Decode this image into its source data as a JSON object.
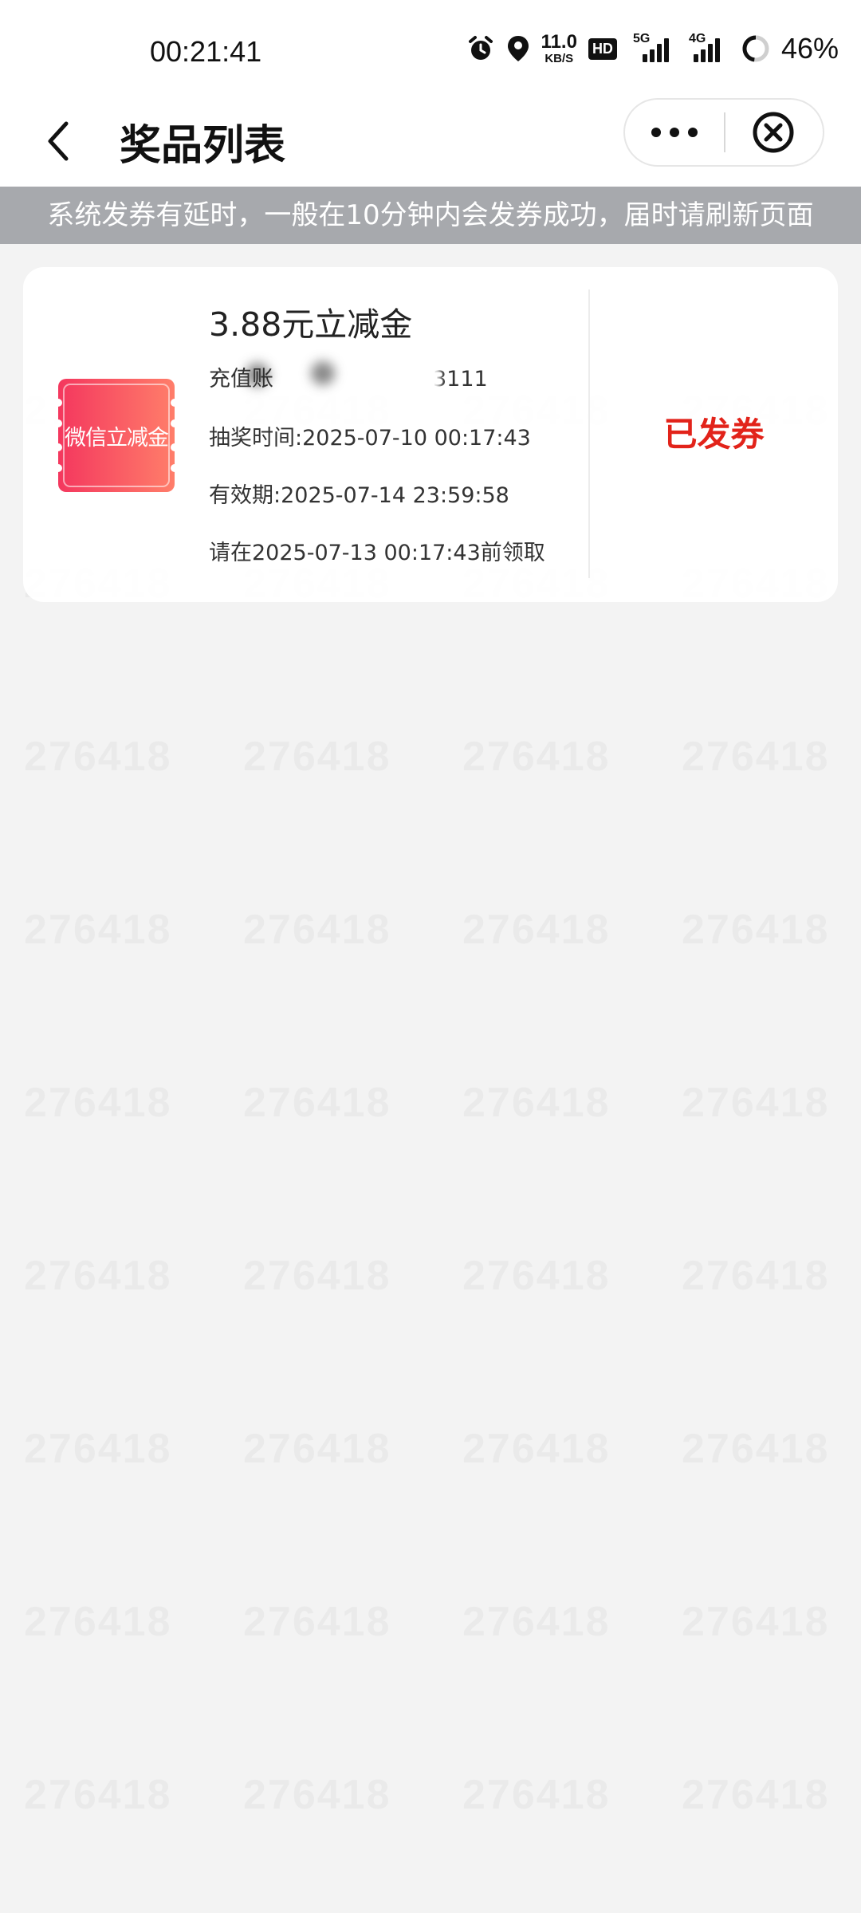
{
  "status_bar": {
    "time": "00:21:41",
    "net_speed_value": "11.0",
    "net_speed_unit": "KB/S",
    "hd_badge": "HD",
    "signal_5g_label": "5G",
    "signal_4g_label": "4G",
    "battery_percent": "46%"
  },
  "header": {
    "title": "奖品列表"
  },
  "notice": {
    "text": "系统发券有延时，一般在10分钟内会发券成功，届时请刷新页面"
  },
  "prize": {
    "coupon_image_text": "微信立减金",
    "title": "3.88元立减金",
    "account_label": "充值账",
    "account_suffix": "3111",
    "draw_time": "抽奖时间:2025-07-10 00:17:43",
    "valid_until": "有效期:2025-07-14 23:59:58",
    "claim_before": "请在2025-07-13 00:17:43前领取",
    "status": "已发券"
  },
  "watermark": {
    "text": "276418"
  },
  "colors": {
    "accent_red": "#e2231a",
    "notice_bg": "#a7a9ad",
    "coupon_gradient_start": "#f4375e",
    "coupon_gradient_end": "#ff7e6a"
  }
}
